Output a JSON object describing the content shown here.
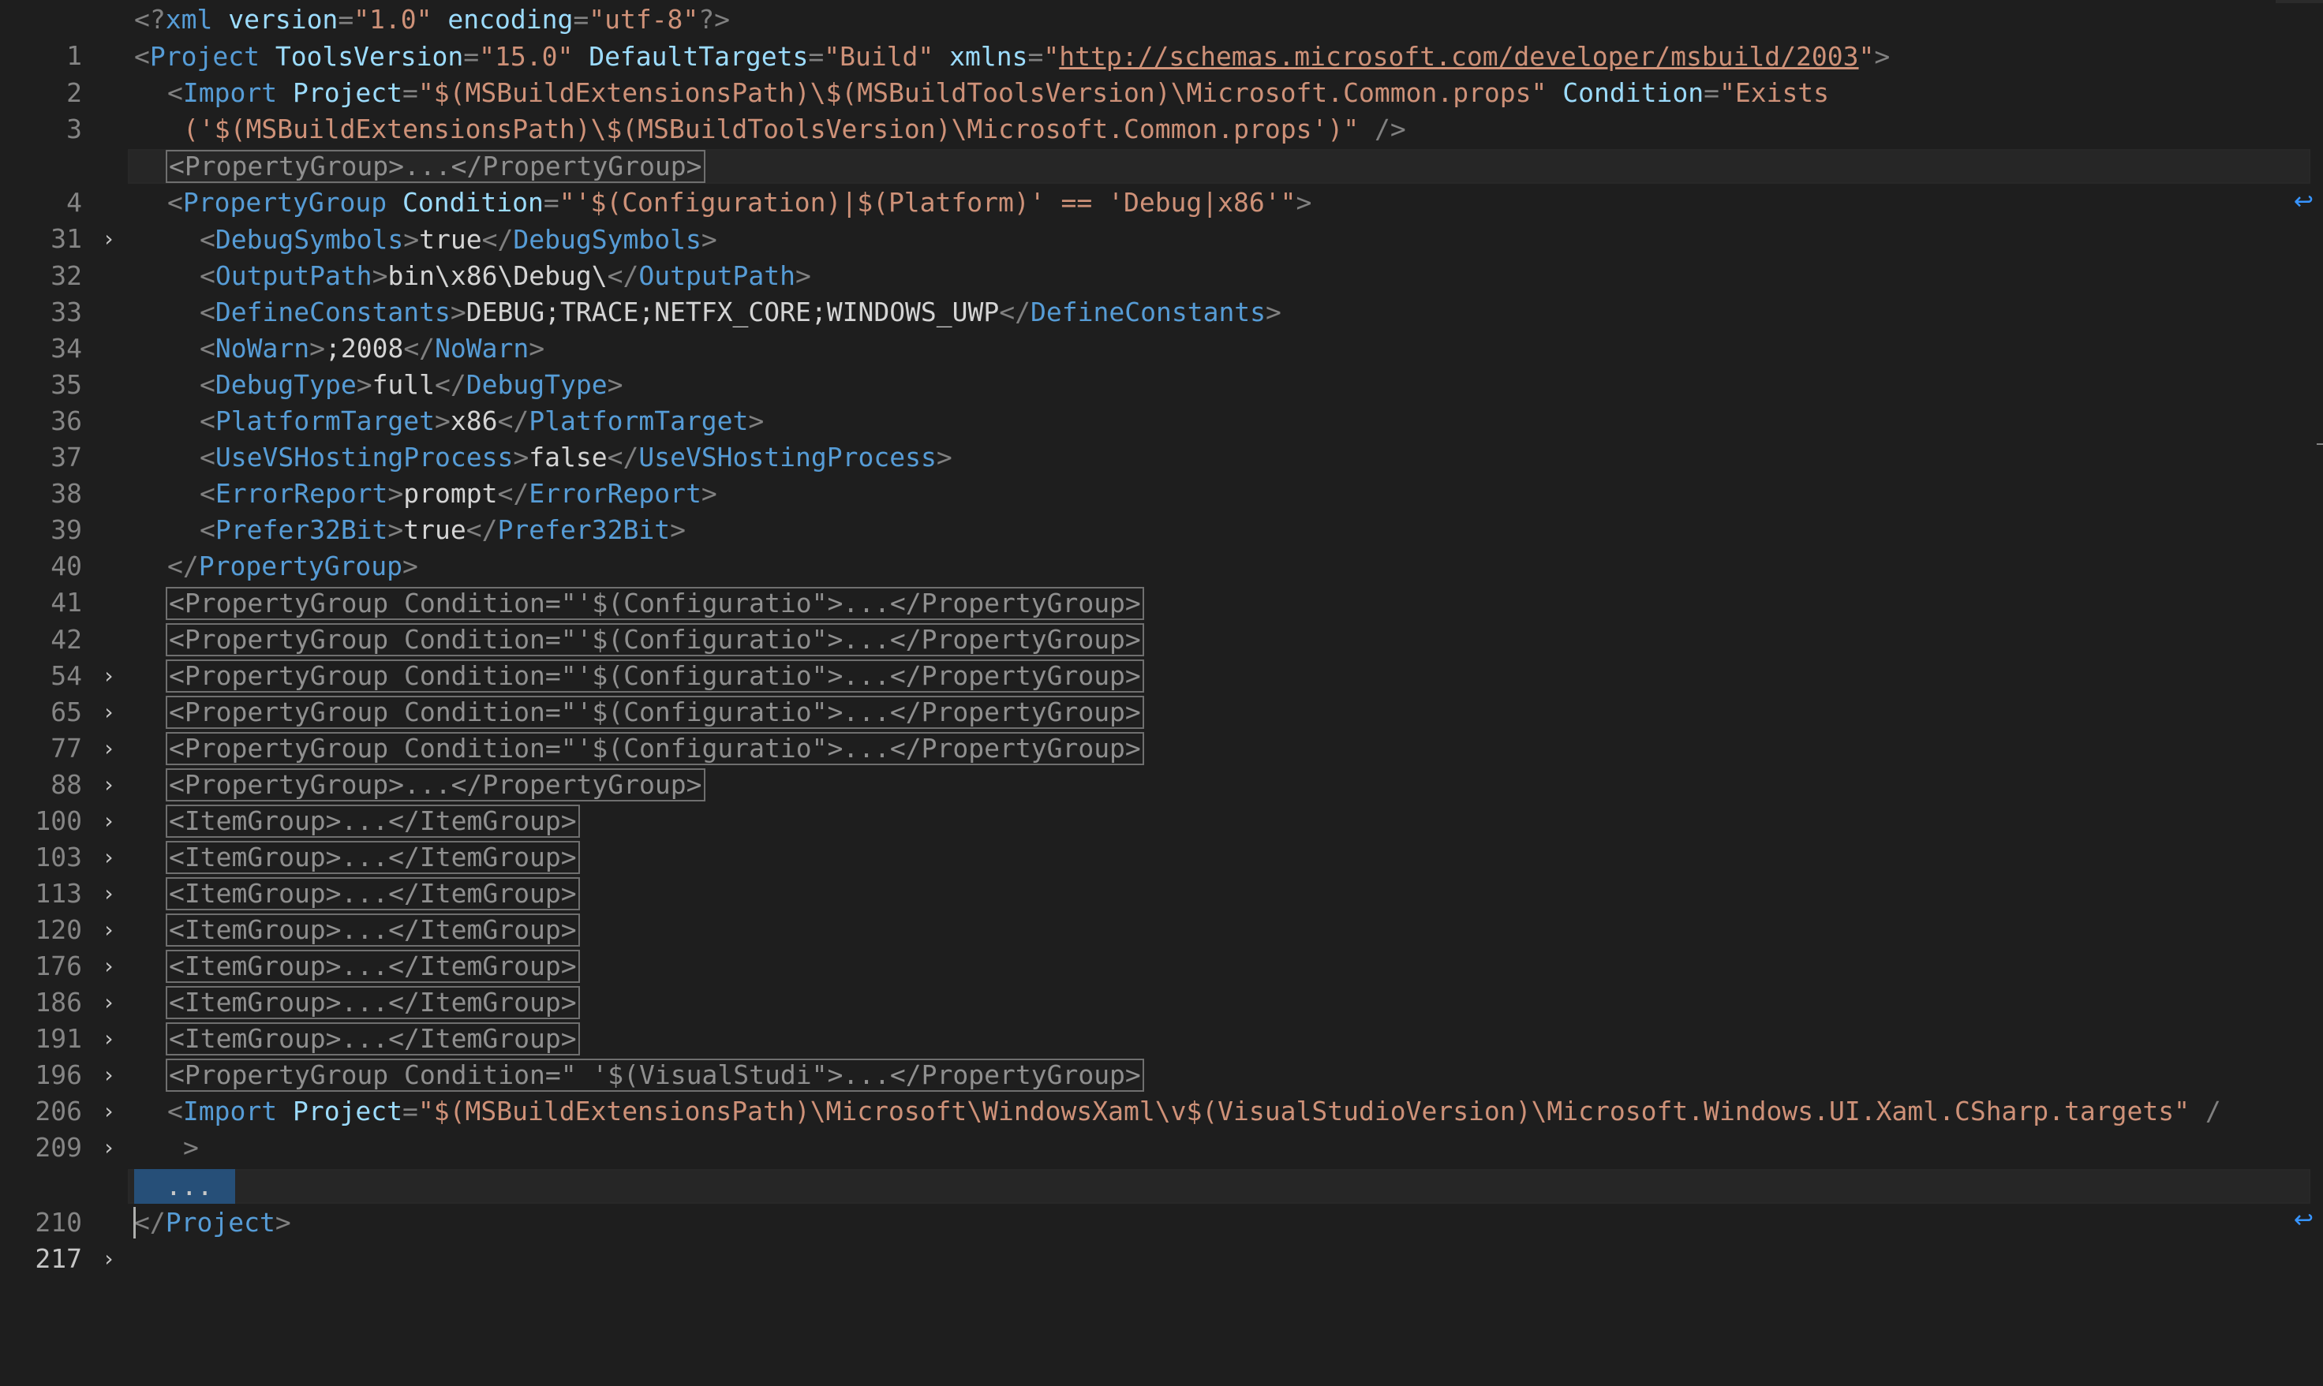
{
  "editor": {
    "lines": {
      "l1": {
        "num": "1",
        "t1": "<?",
        "n1": "xml",
        "a1": " version",
        "e1": "=",
        "s1": "\"1.0\"",
        "a2": " encoding",
        "e2": "=",
        "s2": "\"utf-8\"",
        "t2": "?>"
      },
      "l2": {
        "num": "2",
        "t1": "<",
        "n1": "Project",
        "a1": " ToolsVersion",
        "e1": "=",
        "s1": "\"15.0\"",
        "a2": " DefaultTargets",
        "e2": "=",
        "s2": "\"Build\"",
        "a3": " xmlns",
        "e3": "=",
        "q1": "\"",
        "url": "http://schemas.microsoft.com/developer/msbuild/2003",
        "q2": "\"",
        "t2": ">"
      },
      "l3": {
        "num": "3",
        "t1": "<",
        "n1": "Import",
        "a1": " Project",
        "e1": "=",
        "s1": "\"$(MSBuildExtensionsPath)\\$(MSBuildToolsVersion)\\Microsoft.Common.props\"",
        "a2": " Condition",
        "e2": "=",
        "s2": "\"Exists"
      },
      "l3b": {
        "s1": "('$(MSBuildExtensionsPath)\\$(MSBuildToolsVersion)\\Microsoft.Common.props')\"",
        "t1": " />"
      },
      "l4": {
        "num": "4",
        "folded": "<PropertyGroup>...</PropertyGroup>"
      },
      "l31": {
        "num": "31",
        "t1": "<",
        "n1": "PropertyGroup",
        "a1": " Condition",
        "e1": "=",
        "s1": "\"'$(Configuration)|$(Platform)' == 'Debug|x86'\"",
        "t2": ">"
      },
      "l32": {
        "num": "32",
        "o": "<",
        "n": "DebugSymbols",
        "c": ">",
        "v": "true",
        "o2": "</",
        "n2": "DebugSymbols",
        "c2": ">"
      },
      "l33": {
        "num": "33",
        "o": "<",
        "n": "OutputPath",
        "c": ">",
        "v": "bin\\x86\\Debug\\",
        "o2": "</",
        "n2": "OutputPath",
        "c2": ">"
      },
      "l34": {
        "num": "34",
        "o": "<",
        "n": "DefineConstants",
        "c": ">",
        "v": "DEBUG;TRACE;NETFX_CORE;WINDOWS_UWP",
        "o2": "</",
        "n2": "DefineConstants",
        "c2": ">"
      },
      "l35": {
        "num": "35",
        "o": "<",
        "n": "NoWarn",
        "c": ">",
        "v": ";2008",
        "o2": "</",
        "n2": "NoWarn",
        "c2": ">"
      },
      "l36": {
        "num": "36",
        "o": "<",
        "n": "DebugType",
        "c": ">",
        "v": "full",
        "o2": "</",
        "n2": "DebugType",
        "c2": ">"
      },
      "l37": {
        "num": "37",
        "o": "<",
        "n": "PlatformTarget",
        "c": ">",
        "v": "x86",
        "o2": "</",
        "n2": "PlatformTarget",
        "c2": ">"
      },
      "l38": {
        "num": "38",
        "o": "<",
        "n": "UseVSHostingProcess",
        "c": ">",
        "v": "false",
        "o2": "</",
        "n2": "UseVSHostingProcess",
        "c2": ">"
      },
      "l39": {
        "num": "39",
        "o": "<",
        "n": "ErrorReport",
        "c": ">",
        "v": "prompt",
        "o2": "</",
        "n2": "ErrorReport",
        "c2": ">"
      },
      "l40": {
        "num": "40",
        "o": "<",
        "n": "Prefer32Bit",
        "c": ">",
        "v": "true",
        "o2": "</",
        "n2": "Prefer32Bit",
        "c2": ">"
      },
      "l41": {
        "num": "41",
        "o": "</",
        "n": "PropertyGroup",
        "c": ">"
      },
      "l42": {
        "num": "42",
        "folded": "<PropertyGroup Condition=\"'$(Configuratio\">...</PropertyGroup>"
      },
      "l54": {
        "num": "54",
        "folded": "<PropertyGroup Condition=\"'$(Configuratio\">...</PropertyGroup>"
      },
      "l65": {
        "num": "65",
        "folded": "<PropertyGroup Condition=\"'$(Configuratio\">...</PropertyGroup>"
      },
      "l77": {
        "num": "77",
        "folded": "<PropertyGroup Condition=\"'$(Configuratio\">...</PropertyGroup>"
      },
      "l88": {
        "num": "88",
        "folded": "<PropertyGroup Condition=\"'$(Configuratio\">...</PropertyGroup>"
      },
      "l100": {
        "num": "100",
        "folded": "<PropertyGroup>...</PropertyGroup>"
      },
      "l103": {
        "num": "103",
        "folded": "<ItemGroup>...</ItemGroup>"
      },
      "l113": {
        "num": "113",
        "folded": "<ItemGroup>...</ItemGroup>"
      },
      "l120": {
        "num": "120",
        "folded": "<ItemGroup>...</ItemGroup>"
      },
      "l176": {
        "num": "176",
        "folded": "<ItemGroup>...</ItemGroup>"
      },
      "l186": {
        "num": "186",
        "folded": "<ItemGroup>...</ItemGroup>"
      },
      "l191": {
        "num": "191",
        "folded": "<ItemGroup>...</ItemGroup>"
      },
      "l196": {
        "num": "196",
        "folded": "<ItemGroup>...</ItemGroup>"
      },
      "l206": {
        "num": "206",
        "folded": "<PropertyGroup Condition=\" '$(VisualStudi\">...</PropertyGroup>"
      },
      "l209": {
        "num": "209",
        "t1": "<",
        "n1": "Import",
        "a1": " Project",
        "e1": "=",
        "s1": "\"$(MSBuildExtensionsPath)\\Microsoft\\WindowsXaml\\v$(VisualStudioVersion)\\Microsoft.Windows.UI.Xaml.CSharp.targets\"",
        "t2": " /"
      },
      "l209b": {
        "t1": ">"
      },
      "l210": {
        "num": "210",
        "folded": "..."
      },
      "l217": {
        "num": "217",
        "o": "</",
        "n": "Project",
        "c": ">"
      }
    },
    "fold_glyph": "›",
    "wrap_glyph": "↩",
    "colors": {
      "background": "#1e1e1e",
      "tag_name": "#569cd6",
      "attribute": "#9cdcfe",
      "string": "#ce9178",
      "punctuation": "#808080",
      "selection": "#264f78"
    }
  }
}
